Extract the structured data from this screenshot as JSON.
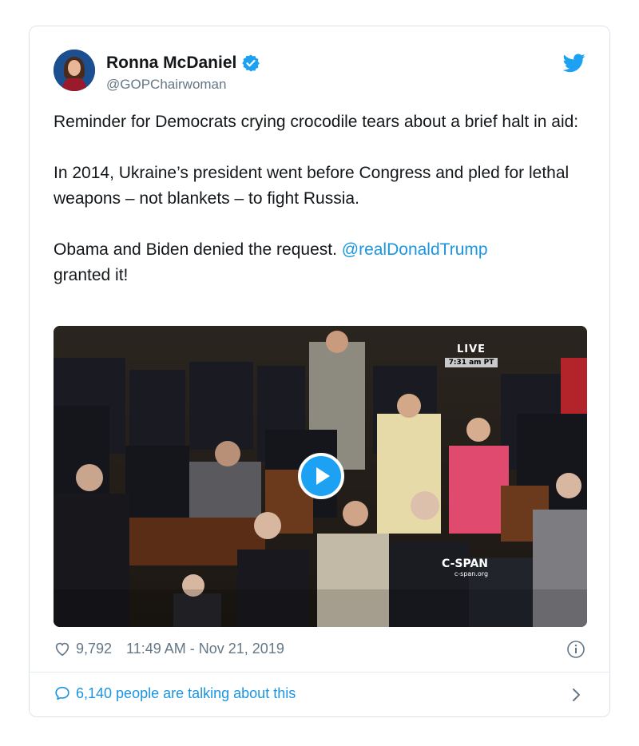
{
  "tweet": {
    "author_name": "Ronna McDaniel",
    "handle": "@GOPChairwoman",
    "text_p1": "Reminder for Democrats crying crocodile tears about a brief halt in aid:",
    "text_p2": "In 2014, Ukraine’s president went before Congress and pled for lethal weapons – not blankets – to fight Russia.",
    "text_p3_a": "Obama and Biden denied the request. ",
    "text_p3_mention": "@realDonaldTrump",
    "text_p3_b": " granted it!",
    "likes": "9,792",
    "timestamp": "11:49 AM - Nov 21, 2019",
    "talking": "6,140 people are talking about this"
  },
  "video": {
    "live_label": "LIVE",
    "live_time": "7:31 am PT",
    "network": "C-SPAN",
    "network_url": "c-span.org"
  },
  "icons": {
    "verified": "verified-badge-icon",
    "bird": "twitter-bird-icon",
    "play": "play-icon",
    "heart": "heart-icon",
    "info": "info-icon",
    "comment": "comment-icon",
    "chevron": "chevron-right-icon"
  },
  "colors": {
    "link": "#1b95e0",
    "muted": "#657786",
    "text": "#14171a",
    "twitter_blue": "#1da1f2"
  }
}
